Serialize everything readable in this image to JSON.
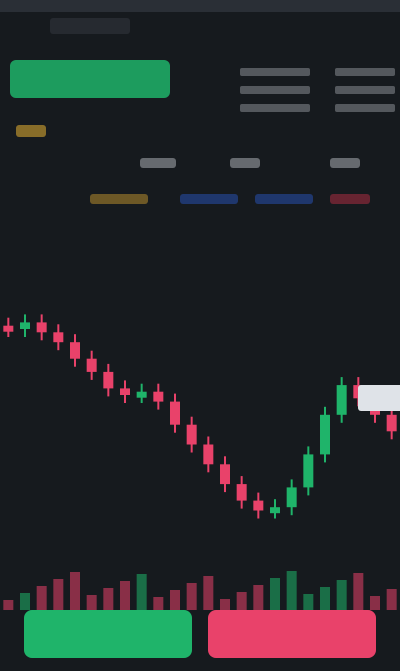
{
  "app": {
    "title": ""
  },
  "colors": {
    "background": "#161a1e",
    "bull": "#1fb46a",
    "bear": "#e9426a",
    "accent": "#d6a530"
  },
  "header": {
    "pair": "",
    "price": "",
    "change": ""
  },
  "price_label": "",
  "actions": {
    "buy_label": "",
    "sell_label": ""
  },
  "chart_data": {
    "type": "line",
    "title": "",
    "series": [
      {
        "name": "",
        "values": [
          70,
          72,
          69,
          66,
          61,
          57,
          52,
          50,
          51,
          48,
          41,
          35,
          29,
          23,
          18,
          15,
          16,
          22,
          32,
          44,
          53,
          49,
          44,
          39
        ]
      }
    ],
    "xlabel": "",
    "ylabel": "",
    "ylim": [
      0,
      100
    ]
  }
}
